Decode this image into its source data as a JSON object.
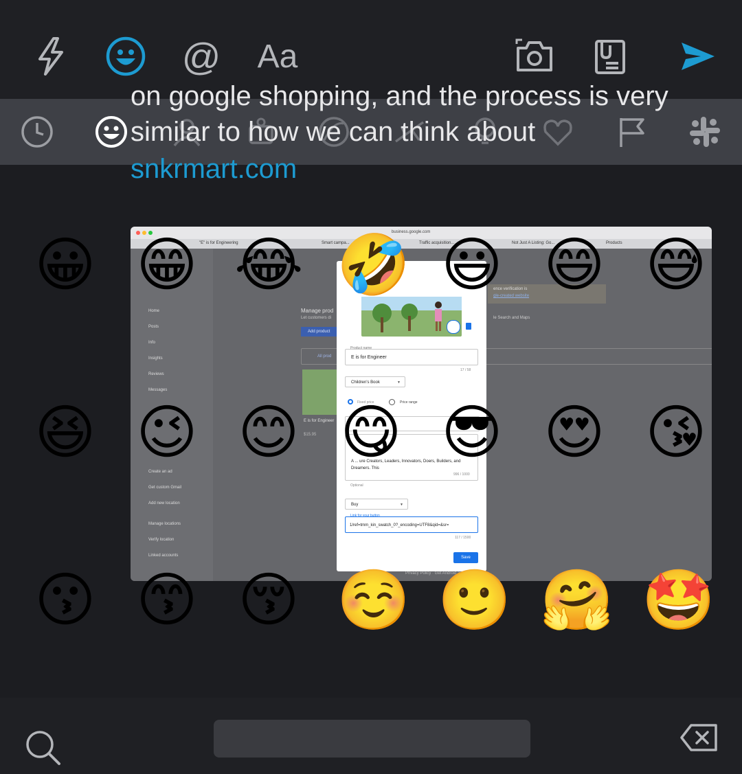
{
  "toolbar": {
    "format_label": "Aa",
    "at_label": "@"
  },
  "message": {
    "line1": "on google shopping, and the process is very",
    "line2": "similar to how we can think about",
    "link": "snkrmart.com"
  },
  "categories": [
    "recent-icon",
    "smileys-icon",
    "people-icon",
    "nature-icon",
    "food-icon",
    "activity-icon",
    "travel-icon",
    "objects-icon",
    "symbols-icon",
    "flags-icon",
    "slack-icon"
  ],
  "emoji_rows": [
    [
      "😀",
      "😁",
      "😂",
      "🤣",
      "😃",
      "😄",
      "😅"
    ],
    [
      "😆",
      "😉",
      "😊",
      "😋",
      "😎",
      "😍",
      "😘"
    ],
    [
      "😗",
      "😙",
      "😚",
      "☺️",
      "🙂",
      "🤗",
      "🤩"
    ]
  ],
  "screenshot": {
    "url": "business.google.com",
    "tabs": [
      "\"E\" is for Engineering",
      "Smart campa...",
      "Traffic acquisition...",
      "Not Just A Listing: Go...",
      "Products"
    ],
    "sidebar": [
      "Home",
      "Posts",
      "Info",
      "Insights",
      "Reviews",
      "Messages",
      "Create an ad",
      "Get custom Gmail",
      "Add new location",
      "Manage locations",
      "Verify location",
      "Linked accounts"
    ],
    "main_heading": "Manage prod",
    "main_sub": "Let customers di",
    "add_product": "Add product",
    "all_products": "All prod",
    "product_card_name": "E is for Engineer",
    "product_card_price": "$15.95",
    "verify_text": "ence verification is",
    "verify_link": "gle-created website",
    "search_maps": "le Search and Maps",
    "dialog": {
      "product_name_label": "Product name",
      "product_name_value": "E is for Engineer",
      "product_name_count": "17 / 58",
      "category": "Children's Book",
      "price_opt1": "Fixed price",
      "price_opt2": "Price range",
      "description": "A ... ure Creators, Leaders, Innovators, Doers, Builders, and Dreamers. This",
      "desc_count": "996 / 1000",
      "optional": "Optional",
      "button_type": "Buy",
      "link_label": "Link for your button",
      "link_value": "1/ref=tmm_kin_swatch_0?_encoding=UTF8&qid=&sr=",
      "link_count": "117 / 1500",
      "save": "Save"
    },
    "footer": "Privacy Policy · Get Android app · Get iPhone"
  },
  "bottom": {
    "progress_fraction": 0.05,
    "search_placeholder": ""
  },
  "colors": {
    "accent": "#1d9bd1",
    "icon_gray": "#b4b6ba",
    "background": "#1c1d21"
  }
}
